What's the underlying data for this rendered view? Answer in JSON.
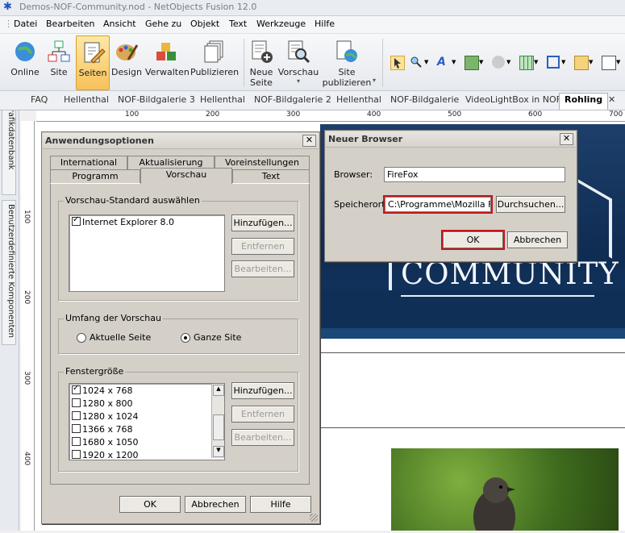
{
  "window": {
    "title": "Demos-NOF-Community.nod - NetObjects Fusion 12.0"
  },
  "menu": [
    "Datei",
    "Bearbeiten",
    "Ansicht",
    "Gehe zu",
    "Objekt",
    "Text",
    "Werkzeuge",
    "Hilfe"
  ],
  "ribbon": {
    "online": "Online",
    "site": "Site",
    "seiten": "Seiten",
    "design": "Design",
    "verwalten": "Verwalten",
    "publizieren": "Publizieren",
    "neue": "Neue",
    "seite": "Seite",
    "vorschau": "Vorschau",
    "site2": "Site",
    "publizieren2": "publizieren"
  },
  "page_tabs": [
    "FAQ",
    "Hellenthal",
    "NOF-Bildgalerie 3",
    "Hellenthal",
    "NOF-Bildgalerie 2",
    "Hellenthal",
    "NOF-Bildgalerie",
    "VideoLightBox in NOF",
    "Rohling"
  ],
  "page_tabs_close": "✕",
  "left_tabs": [
    "Grafikdatenbank",
    "Benutzerdefinierte Komponenten"
  ],
  "ruler_h": [
    "100",
    "200",
    "300",
    "400",
    "500",
    "600",
    "700"
  ],
  "ruler_v": [
    "100",
    "200",
    "300",
    "400"
  ],
  "canvas": {
    "banner_text": "COMMUNITY"
  },
  "anwendung": {
    "title": "Anwendungsoptionen",
    "close": "✕",
    "tabs_back": [
      "International",
      "Aktualisierung",
      "Voreinstellungen"
    ],
    "tabs_front": [
      "Programm",
      "Vorschau",
      "Text"
    ],
    "grp_vorschau": "Vorschau-Standard auswählen",
    "browsers": [
      "Internet Explorer 8.0"
    ],
    "btn_hinzufuegen": "Hinzufügen...",
    "btn_entfernen": "Entfernen",
    "btn_bearbeiten": "Bearbeiten...",
    "grp_umfang": "Umfang der Vorschau",
    "radio_aktuelle": "Aktuelle Seite",
    "radio_ganze": "Ganze Site",
    "grp_fenster": "Fenstergröße",
    "sizes": [
      "1024 x 768",
      "1280 x 800",
      "1280 x 1024",
      "1366 x 768",
      "1680 x 1050",
      "1920 x 1200"
    ],
    "btn_hinzufuegen2": "Hinzufügen...",
    "btn_entfernen2": "Entfernen",
    "btn_bearbeiten2": "Bearbeiten...",
    "ok": "OK",
    "abbrechen": "Abbrechen",
    "hilfe": "Hilfe"
  },
  "neuer": {
    "title": "Neuer Browser",
    "close": "✕",
    "browser_label": "Browser:",
    "browser_value": "FireFox",
    "speicherort_label": "Speicherort:",
    "speicherort_value": "C:\\Programme\\Mozilla Fire",
    "durchsuchen": "Durchsuchen...",
    "ok": "OK",
    "abbrechen": "Abbrechen"
  }
}
